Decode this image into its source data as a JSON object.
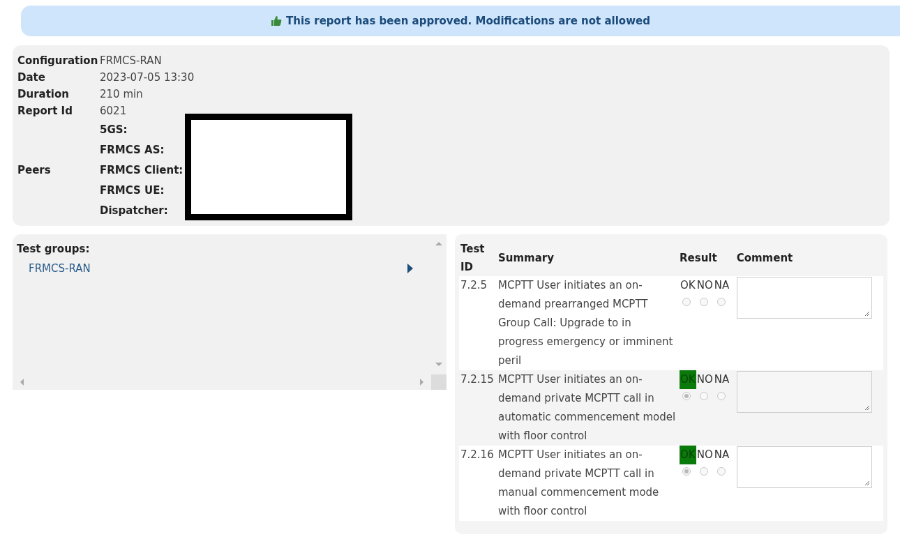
{
  "banner": {
    "text": "This report has been approved. Modifications are not allowed"
  },
  "info": [
    {
      "label": "Configuration",
      "value": "FRMCS-RAN"
    },
    {
      "label": "Date",
      "value": "2023-07-05 13:30"
    },
    {
      "label": "Duration",
      "value": "210 min"
    },
    {
      "label": "Report Id",
      "value": "6021"
    }
  ],
  "peers": {
    "label": "Peers",
    "items": [
      "5GS:",
      "FRMCS AS:",
      "FRMCS Client:",
      "FRMCS UE:",
      "Dispatcher:"
    ]
  },
  "test_groups": {
    "title": "Test groups:",
    "items": [
      {
        "label": "FRMCS-RAN"
      }
    ]
  },
  "table": {
    "columns": [
      "Test ID",
      "Summary",
      "Result",
      "Comment"
    ],
    "rows": [
      {
        "id": "7.2.5",
        "summary": "MCPTT User initiates an on-demand prearranged MCPTT Group Call: Upgrade to in progress emergency or imminent peril",
        "results": [
          {
            "label": "OK",
            "selected": false
          },
          {
            "label": "NO",
            "selected": false
          },
          {
            "label": "NA",
            "selected": false
          }
        ]
      },
      {
        "id": "7.2.15",
        "summary": "MCPTT User initiates an on-demand private MCPTT call in automatic commencement model with floor control",
        "results": [
          {
            "label": "OK",
            "selected": true
          },
          {
            "label": "NO",
            "selected": false
          },
          {
            "label": "NA",
            "selected": false
          }
        ]
      },
      {
        "id": "7.2.16",
        "summary": "MCPTT User initiates an on-demand private MCPTT call in manual commencement mode with floor control",
        "results": [
          {
            "label": "OK",
            "selected": true
          },
          {
            "label": "NO",
            "selected": false
          },
          {
            "label": "NA",
            "selected": false
          }
        ]
      }
    ]
  }
}
